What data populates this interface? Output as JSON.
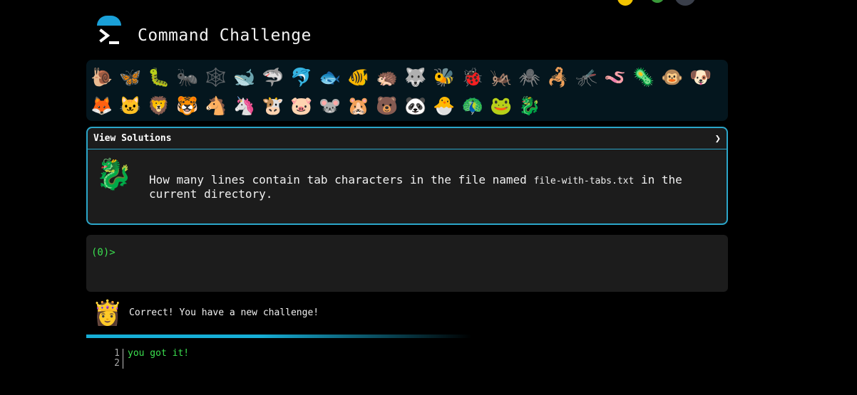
{
  "app": {
    "title": "Command Challenge"
  },
  "animals": {
    "row1": [
      "🐌",
      "🦋",
      "🐛",
      "🐜",
      "🕸️",
      "🐋",
      "🦈",
      "🐬",
      "🐟",
      "🐠",
      "🦔",
      "🐺",
      "🐝",
      "🐞",
      "🦗",
      "🕷️",
      "🦂",
      "🦟",
      "🪱",
      "🦠",
      "🐵",
      "🐶"
    ],
    "row2": [
      "🦊",
      "🐱",
      "🦁",
      "🐯",
      "🐴",
      "🦄",
      "🐮",
      "🐷",
      "🐭",
      "🐹",
      "🐻",
      "🐼",
      "🐣",
      "🦚",
      "🐸",
      "🐉"
    ]
  },
  "solutions": {
    "label": "View Solutions",
    "chevron": "❯",
    "icon": "🐉",
    "question_prefix": "How many lines contain tab characters in the file named ",
    "question_file": "file-with-tabs.txt",
    "question_suffix": " in the current directory."
  },
  "terminal": {
    "prompt": "(0)>"
  },
  "result": {
    "icon": "👸",
    "message": "Correct! You have a new challenge!"
  },
  "output": {
    "lines": [
      {
        "num": "1",
        "text": "you got it!"
      },
      {
        "num": "2",
        "text": ""
      }
    ]
  },
  "colors": {
    "accent": "#2ba6c9",
    "prompt": "#3be04f",
    "panel_bg": "#1c1c1c",
    "grid_bg": "#04161e"
  }
}
